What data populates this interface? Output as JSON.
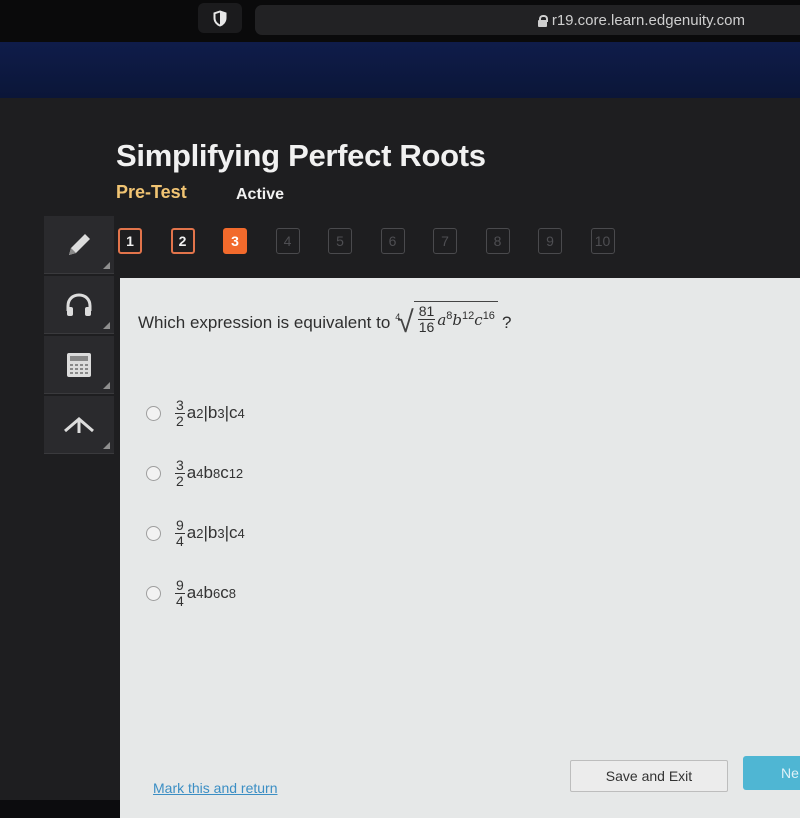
{
  "browser": {
    "url": "r19.core.learn.edgenuity.com",
    "shield_icon": "shield-icon",
    "lock_icon": "lock-icon"
  },
  "header": {
    "title": "Simplifying Perfect Roots",
    "subtitle": "Pre-Test",
    "status": "Active"
  },
  "tools": [
    {
      "name": "pencil-icon"
    },
    {
      "name": "headphones-icon"
    },
    {
      "name": "calculator-icon"
    },
    {
      "name": "collapse-icon"
    }
  ],
  "question_nav": [
    {
      "label": "1",
      "state": "done"
    },
    {
      "label": "2",
      "state": "done"
    },
    {
      "label": "3",
      "state": "current"
    },
    {
      "label": "4",
      "state": "todo"
    },
    {
      "label": "5",
      "state": "todo"
    },
    {
      "label": "6",
      "state": "todo"
    },
    {
      "label": "7",
      "state": "todo"
    },
    {
      "label": "8",
      "state": "todo"
    },
    {
      "label": "9",
      "state": "todo"
    },
    {
      "label": "10",
      "state": "todo"
    }
  ],
  "question": {
    "prompt": "Which expression is equivalent to",
    "root_index": "4",
    "radicand": {
      "frac_num": "81",
      "frac_den": "16",
      "terms": [
        {
          "var": "a",
          "exp": "8"
        },
        {
          "var": "b",
          "exp": "12"
        },
        {
          "var": "c",
          "exp": "16"
        }
      ]
    },
    "end": "?"
  },
  "options": [
    {
      "frac_num": "3",
      "frac_den": "2",
      "parts": [
        {
          "t": "a",
          "e": "2"
        },
        {
          "t": "|b",
          "e": "3"
        },
        {
          "t": "|c",
          "e": "4"
        }
      ]
    },
    {
      "frac_num": "3",
      "frac_den": "2",
      "parts": [
        {
          "t": "a",
          "e": "4"
        },
        {
          "t": "b",
          "e": "8"
        },
        {
          "t": "c",
          "e": "12"
        }
      ]
    },
    {
      "frac_num": "9",
      "frac_den": "4",
      "parts": [
        {
          "t": "a",
          "e": "2"
        },
        {
          "t": "|b",
          "e": "3"
        },
        {
          "t": "|c",
          "e": "4"
        }
      ]
    },
    {
      "frac_num": "9",
      "frac_den": "4",
      "parts": [
        {
          "t": "a",
          "e": "4"
        },
        {
          "t": "b",
          "e": "6"
        },
        {
          "t": "c",
          "e": "8"
        }
      ]
    }
  ],
  "footer": {
    "mark_label": "Mark this and return",
    "save_label": "Save and Exit",
    "next_label": "Ne"
  }
}
